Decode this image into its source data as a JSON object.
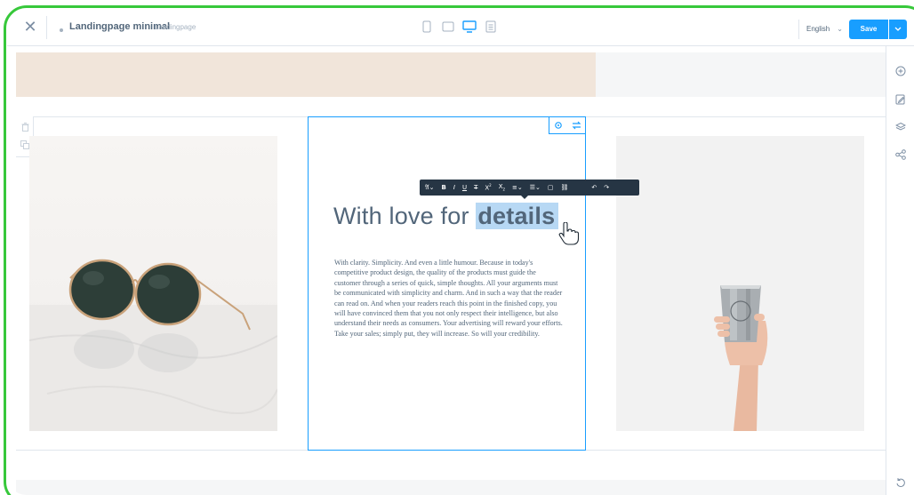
{
  "topbar": {
    "page_name": "Landingpage minimal",
    "page_type": "Landingpage",
    "language": "English",
    "save_label": "Save"
  },
  "devices": [
    "mobile",
    "tablet",
    "desktop",
    "list"
  ],
  "editor": {
    "heading_plain": "With love for ",
    "heading_highlight": "details",
    "body": "With clarity. Simplicity. And even a little humour. Because in today's competitive product design, the quality of the products must guide the customer through a series of quick, simple thoughts. All your arguments must be communicated with simplicity and charm. And in such a way that the reader can read on. And when your readers reach this point in the finished copy, you will have convinced them that you not only respect their intelligence, but also understand their needs as consumers. Your advertising will reward your efforts. Take your sales; simply put, they will increase. So will your credibility."
  },
  "toolbar": {
    "items": [
      "A",
      "B",
      "I",
      "U",
      "T",
      "X",
      "X",
      "≡",
      "≡",
      "□",
      "🔗",
      "",
      "↶",
      "↷"
    ]
  },
  "icons": {
    "close": "close-icon",
    "rail": [
      "add-block-icon",
      "edit-icon",
      "layers-icon",
      "share-icon",
      "undo-icon"
    ]
  },
  "colors": {
    "accent": "#189eff",
    "toolbar": "#263544",
    "highlight": "#b7d8f4",
    "frame": "#37c83b",
    "beige": "#f1e5da"
  }
}
